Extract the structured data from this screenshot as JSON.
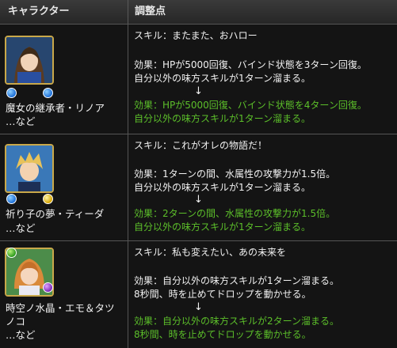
{
  "headers": {
    "character": "キャラクター",
    "changes": "調整点"
  },
  "rows": [
    {
      "name_lines": [
        "魔女の継承者・リノア",
        "…など"
      ],
      "attributes": [
        "water",
        "water"
      ],
      "skill": "スキル：またまた、おハロー",
      "before": [
        "効果：HPが5000回復、バインド状態を3ターン回復。",
        "自分以外の味方スキルが1ターン溜まる。"
      ],
      "arrow": "↓",
      "after": [
        "効果：HPが5000回復、バインド状態を4ターン回復。",
        "自分以外の味方スキルが1ターン溜まる。"
      ],
      "colors": {
        "frame": "#c9a84a",
        "bg": "#1f3a63",
        "hair": "#6b4b2a"
      }
    },
    {
      "name_lines": [
        "祈り子の夢・ティーダ",
        "…など"
      ],
      "attributes": [
        "water",
        "light"
      ],
      "skill": "スキル：これがオレの物語だ！",
      "before": [
        "効果：1ターンの間、水属性の攻撃力が1.5倍。",
        "自分以外の味方スキルが1ターン溜まる。"
      ],
      "arrow": "↓",
      "after": [
        "効果：2ターンの間、水属性の攻撃力が1.5倍。",
        "自分以外の味方スキルが1ターン溜まる。"
      ],
      "colors": {
        "frame": "#c9a84a",
        "bg": "#2a5f9c",
        "hair": "#e8c25a"
      }
    },
    {
      "name_lines": [
        "時空ノ水晶・エモ＆タツ",
        "ノコ",
        "…など"
      ],
      "attributes": [
        "wood",
        "dark"
      ],
      "skill": "スキル：私も変えたい、あの未来を",
      "before": [
        "効果：自分以外の味方スキルが1ターン溜まる。",
        "8秒間、時を止めてドロップを動かせる。"
      ],
      "arrow": "↓",
      "after": [
        "効果：自分以外の味方スキルが2ターン溜まる。",
        "8秒間、時を止めてドロップを動かせる。"
      ],
      "colors": {
        "frame": "#c9a84a",
        "bg": "#3a7a3a",
        "hair": "#d98a3a"
      }
    }
  ]
}
